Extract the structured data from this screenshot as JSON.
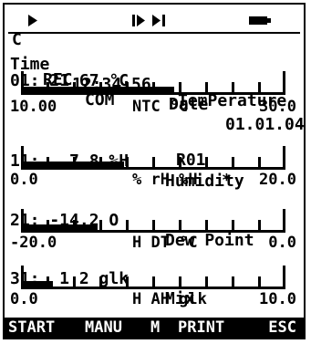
{
  "status_bar": {
    "c": "C",
    "play_icon": "play-icon",
    "rec": "REC",
    "com": "COM",
    "step_icon": "step-icon",
    "end_icon": "skip-end-icon",
    "program": "R01",
    "star": "*",
    "battery_icon": "battery-icon"
  },
  "time_row": {
    "time_label": "Time",
    "time_value": "12:34:56",
    "date_label": "Date",
    "date_value": "01.01.04"
  },
  "channels": [
    {
      "header": "01: 21.67 °C",
      "name": "TemPerature",
      "range_min": "10.00",
      "range_mid": "NTC  °C",
      "range_max": "30.0",
      "fill_fraction": 0.58
    },
    {
      "header": "11:   7.8 %H",
      "name": "Humidity",
      "range_min": "0.0",
      "range_mid": "% rH %H",
      "range_max": "20.0",
      "fill_fraction": 0.39
    },
    {
      "header": "21: -14.2 O",
      "name": "Dew Point",
      "range_min": "-20.0",
      "range_mid": "H DT °C",
      "range_max": "0.0",
      "fill_fraction": 0.29
    },
    {
      "header": "31:  1.2 glk",
      "name": "Mix",
      "range_min": "0.0",
      "range_mid": "H AH glk",
      "range_max": "10.0",
      "fill_fraction": 0.12
    }
  ],
  "softkeys": [
    "START",
    "MANU",
    "M",
    "PRINT",
    "ESC"
  ]
}
